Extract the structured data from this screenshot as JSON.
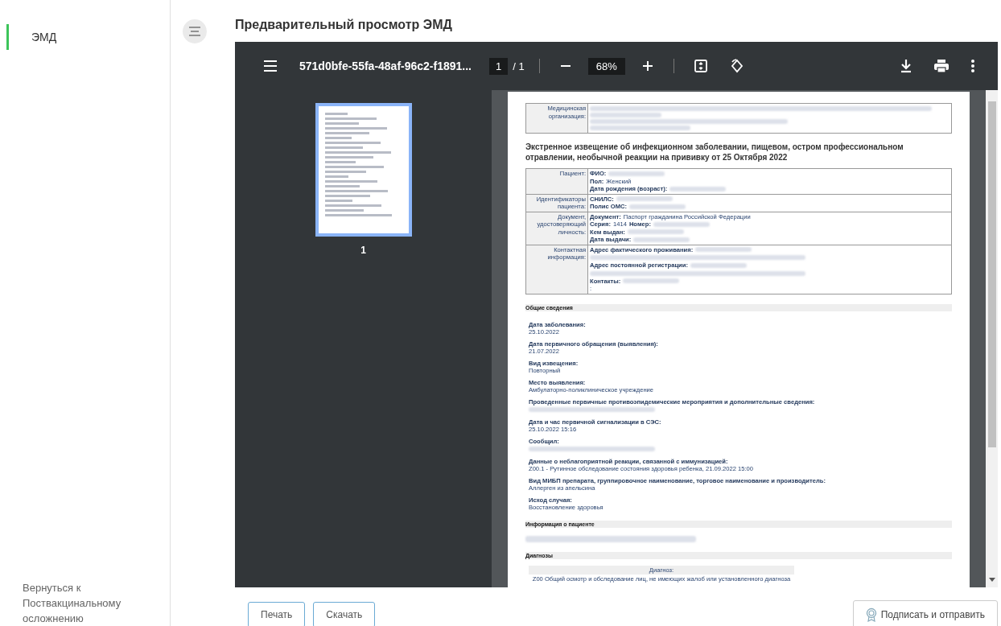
{
  "sidebar": {
    "items": [
      {
        "label": "ЭМД",
        "selected": true
      }
    ],
    "back_link": "Вернуться к Поствакцинальному осложнению"
  },
  "title": "Предварительный просмотр ЭМД",
  "viewer": {
    "file_name": "571d0bfe-55fa-48af-96c2-f1891...",
    "page_current": "1",
    "page_total": "/ 1",
    "zoom": "68%",
    "thumbnails": [
      {
        "label": "1",
        "selected": true
      }
    ]
  },
  "document": {
    "org_table": [
      {
        "label": "Медицинская организация:"
      }
    ],
    "heading": "Экстренное извещение об инфекционном заболевании, пищевом, остром профессиональном отравлении, необычной реакции на прививку от 25 Октября 2022",
    "patient_table": [
      {
        "label": "Пациент:",
        "lines": [
          [
            {
              "label": "ФИО:"
            }
          ],
          [
            {
              "label": "Пол:",
              "value": "Женский"
            }
          ],
          [
            {
              "label": "Дата рождения (возраст):"
            }
          ]
        ]
      },
      {
        "label": "Идентификаторы пациента:",
        "lines": [
          [
            {
              "label": "СНИЛС:"
            }
          ],
          [
            {
              "label": "Полис ОМС:"
            }
          ]
        ]
      },
      {
        "label": "Документ, удостоверяющий личность:",
        "lines": [
          [
            {
              "label": "Документ:",
              "value": "Паспорт гражданина Российской Федерации"
            }
          ],
          [
            {
              "label": "Серия:",
              "value": "1414"
            },
            {
              "label": "Номер:"
            }
          ],
          [
            {
              "label": "Кем выдан:"
            }
          ],
          [
            {
              "label": "Дата выдачи:"
            }
          ]
        ]
      },
      {
        "label": "Контактная информация:",
        "lines": [
          [
            {
              "label": "Адрес фактического проживания:"
            }
          ],
          [
            {
              "redacted_line": true
            }
          ],
          [
            {
              "label": "Адрес постоянной регистрации:"
            }
          ],
          [
            {
              "redacted_line": true
            }
          ],
          [
            {
              "label": "Контакты:"
            }
          ],
          [
            {
              "value": ":"
            }
          ]
        ]
      }
    ],
    "sections": [
      {
        "title": "Общие сведения",
        "fields": [
          {
            "label": "Дата заболевания:",
            "value": "25.10.2022"
          },
          {
            "label": "Дата первичного обращения (выявления):",
            "value": "21.07.2022"
          },
          {
            "label": "Вид извещения:",
            "value": "Повторный"
          },
          {
            "label": "Место выявления:",
            "value": "Амбулаторно-поликлиническое учреждение"
          },
          {
            "label": "Проведенные первичные противоэпидемические мероприятия и дополнительные сведения:"
          },
          {
            "label": "Дата и час первичной сигнализации в СЭС:",
            "value": "25.10.2022 15:16"
          },
          {
            "label": "Сообщил:"
          },
          {
            "label": "Данные о неблагоприятной реакции, связанной с иммунизацией:",
            "value": "Z00.1 - Рутинное обследование состояния здоровья ребенка, 21.09.2022 15:00"
          },
          {
            "label": "Вид МИБП препарата, группировочное наименование, торговое наименование и производитель:",
            "value": "Аллерген из апельсина"
          },
          {
            "label": "Исход случая:",
            "value": "Восстановление здоровья"
          }
        ]
      },
      {
        "title": "Информация о пациенте"
      },
      {
        "title": "Диагнозы",
        "table": {
          "header": "Диагноз:",
          "rows": [
            "Z00 Общий осмотр и обследование лиц, не имеющих жалоб или установленного диагноза"
          ]
        }
      }
    ]
  },
  "buttons": [
    {
      "label": "Печать",
      "kind": "plain"
    },
    {
      "label": "Скачать",
      "kind": "plain"
    },
    {
      "label": "Подписать и отправить",
      "kind": "sign"
    }
  ]
}
